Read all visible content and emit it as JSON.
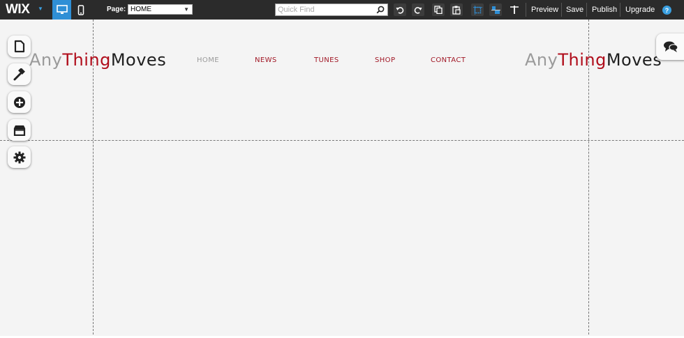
{
  "toolbar": {
    "logo": "WIX",
    "page_label": "Page:",
    "page_select_value": "HOME",
    "quick_find_placeholder": "Quick Find",
    "preview_label": "Preview",
    "save_label": "Save",
    "publish_label": "Publish",
    "upgrade_label": "Upgrade",
    "help_label": "?",
    "icons": [
      "desktop-view-icon",
      "mobile-view-icon",
      "undo-icon",
      "redo-icon",
      "copy-icon",
      "paste-icon",
      "grid-icon",
      "snap-icon",
      "ruler-icon"
    ]
  },
  "site": {
    "logo_left": {
      "part1": "Any",
      "part2": "Thing",
      "part3": "Moves"
    },
    "logo_right": {
      "part1": "Any",
      "part2": "Thing",
      "part3": "Moves"
    },
    "nav": [
      "HOME",
      "NEWS",
      "TUNES",
      "SHOP",
      "CONTACT"
    ]
  },
  "side_panel": [
    "pages-icon",
    "design-icon",
    "add-icon",
    "app-market-icon",
    "settings-icon"
  ],
  "colors": {
    "toolbar_bg": "#2b2b2b",
    "accent_blue": "#2f8fd6",
    "brand_red": "#b00d1b",
    "canvas_bg": "#f4f4f4"
  }
}
